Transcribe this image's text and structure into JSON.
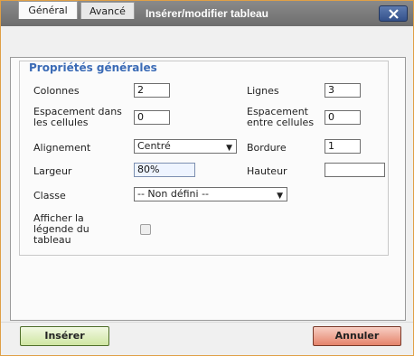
{
  "window": {
    "title": "Insérer/modifier tableau"
  },
  "tabs": [
    {
      "label": "Général"
    },
    {
      "label": "Avancé"
    }
  ],
  "group": {
    "legend": "Propriétés générales",
    "fields": {
      "colonnes": {
        "label": "Colonnes",
        "value": "2"
      },
      "lignes": {
        "label": "Lignes",
        "value": "3"
      },
      "espacement_dans": {
        "label_line1": "Espacement dans",
        "label_line2": "les cellules",
        "value": "0"
      },
      "espacement_entre": {
        "label_line1": "Espacement",
        "label_line2": "entre cellules",
        "value": "0"
      },
      "alignement": {
        "label": "Alignement",
        "value": "Centré"
      },
      "bordure": {
        "label": "Bordure",
        "value": "1"
      },
      "largeur": {
        "label": "Largeur",
        "value": "80%"
      },
      "hauteur": {
        "label": "Hauteur",
        "value": ""
      },
      "classe": {
        "label": "Classe",
        "value": "-- Non défini --"
      },
      "legende": {
        "label_line1": "Afficher la",
        "label_line2": "légende du",
        "label_line3": "tableau",
        "checked": false
      }
    }
  },
  "buttons": {
    "insert": "Insérer",
    "cancel": "Annuler"
  },
  "icons": {
    "close": "close-icon",
    "dropdown": "chevron-down-icon"
  },
  "colors": {
    "accent": "#3b6bb6",
    "insert_button": "#cfe6a2",
    "cancel_button": "#e5836b"
  }
}
